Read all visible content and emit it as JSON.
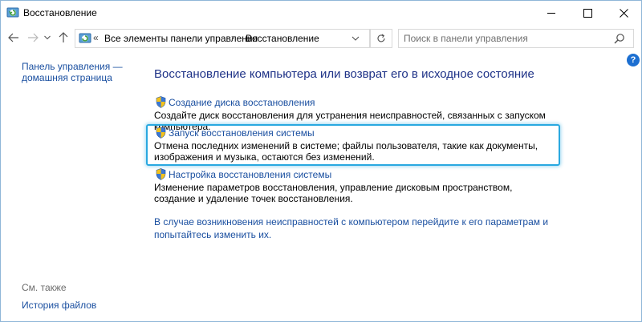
{
  "window": {
    "title": "Восстановление"
  },
  "nav": {
    "breadcrumb_root": "Все элементы панели управления",
    "breadcrumb_current": "Восстановление",
    "search_placeholder": "Поиск в панели управления"
  },
  "sidebar": {
    "home_link": "Панель управления — домашняя страница",
    "see_also": "См. также",
    "file_history": "История файлов"
  },
  "main": {
    "heading": "Восстановление компьютера или возврат его в исходное состояние",
    "tasks": [
      {
        "link": "Создание диска восстановления",
        "description": "Создайте диск восстановления для устранения неисправностей, связанных с запуском компьютера."
      },
      {
        "link": "Запуск восстановления системы",
        "description": "Отмена последних изменений в системе; файлы пользователя, такие как документы, изображения и музыка, остаются без изменений."
      },
      {
        "link": "Настройка восстановления системы",
        "description": "Изменение параметров восстановления, управление дисковым пространством, создание и удаление точек восстановления."
      }
    ],
    "troubleshoot_link": "В случае возникновения неисправностей с компьютером перейдите к его параметрам и попытайтесь изменить их."
  },
  "colors": {
    "link": "#1a4fa0",
    "heading": "#1e3287",
    "highlight": "#29a8e0",
    "help": "#1c6fd1"
  },
  "icons": {
    "title": "control-panel-recovery-icon",
    "task": "uac-shield-icon",
    "search": "search-icon",
    "refresh": "refresh-icon",
    "help": "help-icon"
  }
}
